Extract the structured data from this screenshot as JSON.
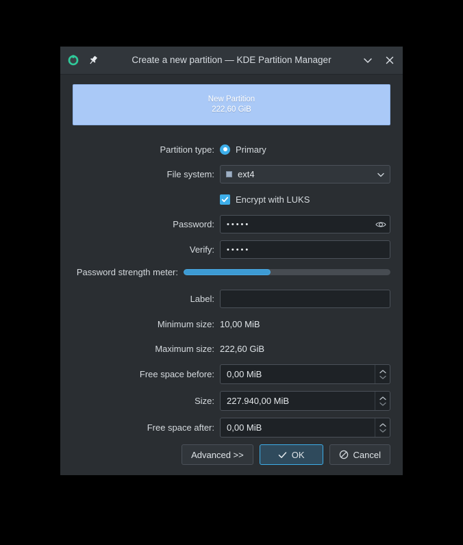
{
  "window": {
    "title": "Create a new partition — KDE Partition Manager",
    "app_icon": "kde-partition-manager-icon",
    "pin_icon": "pin-icon",
    "shade_icon": "chevron-down-icon",
    "close_icon": "close-icon"
  },
  "preview": {
    "name": "New Partition",
    "size": "222,60 GiB",
    "color": "#aac9f7"
  },
  "form": {
    "partition_type": {
      "label": "Partition type:",
      "option": "Primary",
      "selected": true
    },
    "file_system": {
      "label": "File system:",
      "value": "ext4",
      "swatch_color": "#9fb0c4"
    },
    "encrypt": {
      "label": "Encrypt with LUKS",
      "checked": true
    },
    "password": {
      "label": "Password:",
      "value": "•••••",
      "reveal_icon": "eye-icon"
    },
    "verify": {
      "label": "Verify:",
      "value": "•••••"
    },
    "strength": {
      "label": "Password strength meter:",
      "percent": 42,
      "fill_color": "#3d9bd4"
    },
    "label_field": {
      "label": "Label:",
      "value": "",
      "placeholder": ""
    },
    "minimum_size": {
      "label": "Minimum size:",
      "value": "10,00 MiB"
    },
    "maximum_size": {
      "label": "Maximum size:",
      "value": "222,60 GiB"
    },
    "free_before": {
      "label": "Free space before:",
      "value": "0,00 MiB"
    },
    "size": {
      "label": "Size:",
      "value": "227.940,00 MiB"
    },
    "free_after": {
      "label": "Free space after:",
      "value": "0,00 MiB"
    }
  },
  "footer": {
    "advanced": "Advanced >>",
    "ok": "OK",
    "cancel": "Cancel",
    "ok_icon": "check-icon",
    "cancel_icon": "ban-icon",
    "accent_color": "#3daee9"
  }
}
